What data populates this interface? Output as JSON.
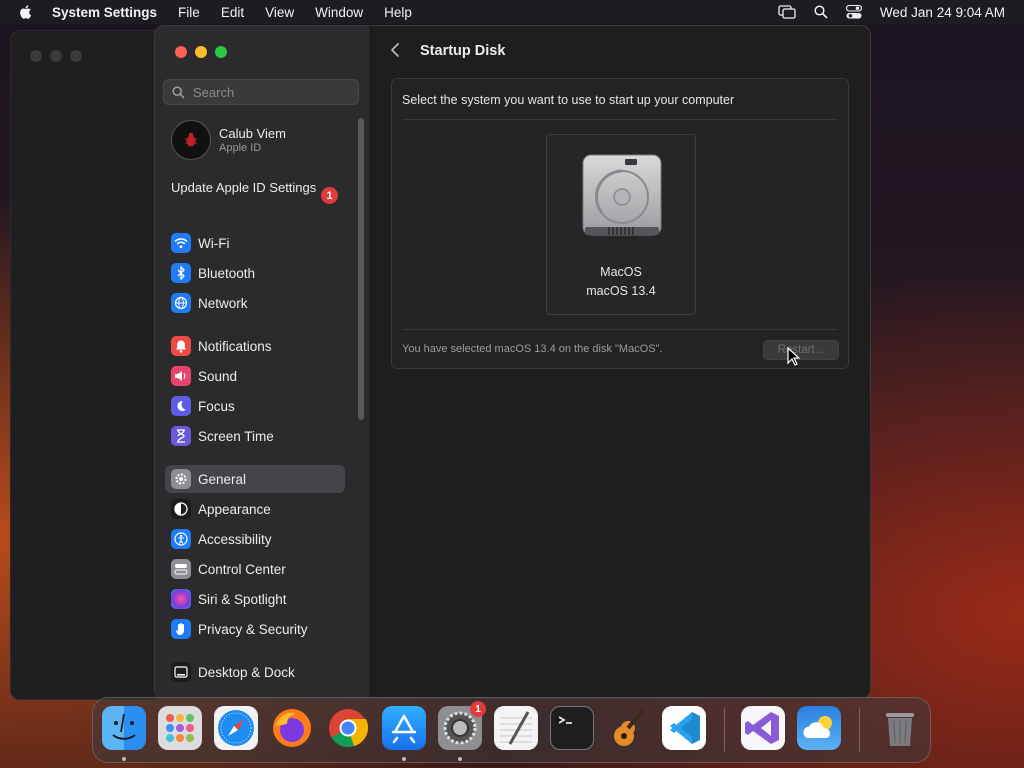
{
  "menubar": {
    "app_name": "System Settings",
    "menus": [
      "File",
      "Edit",
      "View",
      "Window",
      "Help"
    ],
    "clock": "Wed Jan 24  9:04 AM"
  },
  "sidebar": {
    "search_placeholder": "Search",
    "account": {
      "name": "Calub Viem",
      "subtitle": "Apple ID"
    },
    "update": {
      "label": "Update Apple ID Settings",
      "badge": "1"
    },
    "items": [
      {
        "label": "Wi-Fi",
        "icon": "wifi-icon",
        "color": "#1f7cf5"
      },
      {
        "label": "Bluetooth",
        "icon": "bluetooth-icon",
        "color": "#1f7cf5"
      },
      {
        "label": "Network",
        "icon": "globe-icon",
        "color": "#1f7cf5"
      },
      {
        "label": "Notifications",
        "icon": "bell-icon",
        "color": "#eb4a45"
      },
      {
        "label": "Sound",
        "icon": "speaker-icon",
        "color": "#e8446c"
      },
      {
        "label": "Focus",
        "icon": "moon-icon",
        "color": "#5e5ce6"
      },
      {
        "label": "Screen Time",
        "icon": "hourglass-icon",
        "color": "#6a5ad9"
      },
      {
        "label": "General",
        "icon": "gear-icon",
        "color": "#8e8e93"
      },
      {
        "label": "Appearance",
        "icon": "appearance-icon",
        "color": "#1c1c1e"
      },
      {
        "label": "Accessibility",
        "icon": "accessibility-icon",
        "color": "#1f7cf5"
      },
      {
        "label": "Control Center",
        "icon": "control-center-icon",
        "color": "#8e8e93"
      },
      {
        "label": "Siri & Spotlight",
        "icon": "siri-icon",
        "color": "#c04fd8"
      },
      {
        "label": "Privacy & Security",
        "icon": "hand-icon",
        "color": "#1f7cf5"
      },
      {
        "label": "Desktop & Dock",
        "icon": "dock-icon",
        "color": "#1c1c1e"
      }
    ],
    "selected": "General"
  },
  "content": {
    "title": "Startup Disk",
    "prompt": "Select the system you want to use to start up your computer",
    "disk": {
      "name": "MacOS",
      "version": "macOS 13.4"
    },
    "status": "You have selected macOS 13.4 on the disk \"MacOS\".",
    "restart_label": "Restart..."
  },
  "dock": {
    "apps": [
      "Finder",
      "Launchpad",
      "Safari",
      "Firefox",
      "Chrome",
      "App Store",
      "System Settings",
      "TextEdit",
      "Terminal",
      "GarageBand",
      "Visual Studio Code",
      "Visual Studio",
      "Weather",
      "Trash"
    ],
    "system_settings_badge": "1"
  },
  "colors": {
    "accent": "#1f7cf5",
    "badge": "#e23b3b",
    "selected_row": "#454448"
  }
}
